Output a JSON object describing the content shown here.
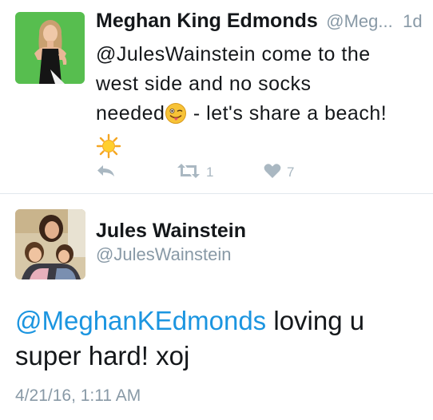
{
  "tweet1": {
    "author_name": "Meghan King Edmonds",
    "author_handle": "@Meg...",
    "timestamp": "1d",
    "text_line1": "@JulesWainstein come to the",
    "text_line2": "west side and no socks",
    "text_line3_before_emoji": "needed",
    "text_line3_after_emoji": " - let's share a beach!",
    "actions": {
      "retweet_count": "1",
      "like_count": "7"
    },
    "icons": {
      "tongue_emoji": "winking-tongue-emoji",
      "sun_emoji": "sun-emoji",
      "reply": "reply-icon",
      "retweet": "retweet-icon",
      "like": "heart-icon"
    }
  },
  "tweet2": {
    "author_name": "Jules Wainstein",
    "author_handle": "@JulesWainstein",
    "mention": "@MeghanKEdmonds",
    "text_after_mention": " loving u",
    "text_line2": "super hard! xoj",
    "date": "4/21/16, 1:11 AM"
  },
  "colors": {
    "text": "#14171a",
    "secondary": "#8899a6",
    "link": "#1b95e0",
    "action_icon": "#aab8c2",
    "divider": "#e1e8ed"
  }
}
